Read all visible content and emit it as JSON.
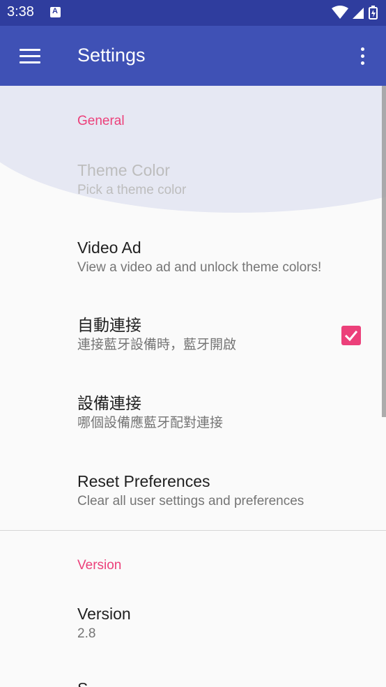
{
  "status": {
    "time": "3:38",
    "notification_letter": "A"
  },
  "appbar": {
    "title": "Settings"
  },
  "sections": {
    "general": "General",
    "version": "Version"
  },
  "prefs": {
    "theme_color": {
      "title": "Theme Color",
      "summary": "Pick a theme color"
    },
    "video_ad": {
      "title": "Video Ad",
      "summary": "View a video ad and unlock theme colors!"
    },
    "auto_connect": {
      "title": "自動連接",
      "summary": "連接藍牙設備時，藍牙開啟",
      "checked": true
    },
    "device_connect": {
      "title": "設備連接",
      "summary": "哪個設備應藍牙配對連接"
    },
    "reset": {
      "title": "Reset Preferences",
      "summary": "Clear all user settings and preferences"
    },
    "version": {
      "title": "Version",
      "summary": "2.8"
    },
    "next": {
      "title": "S"
    }
  },
  "colors": {
    "primary": "#3f51b5",
    "primary_dark": "#2f3d9e",
    "accent": "#ec407a"
  },
  "icons": [
    "menu-icon",
    "overflow-menu-icon",
    "wifi-icon",
    "signal-icon",
    "battery-icon",
    "check-icon"
  ]
}
